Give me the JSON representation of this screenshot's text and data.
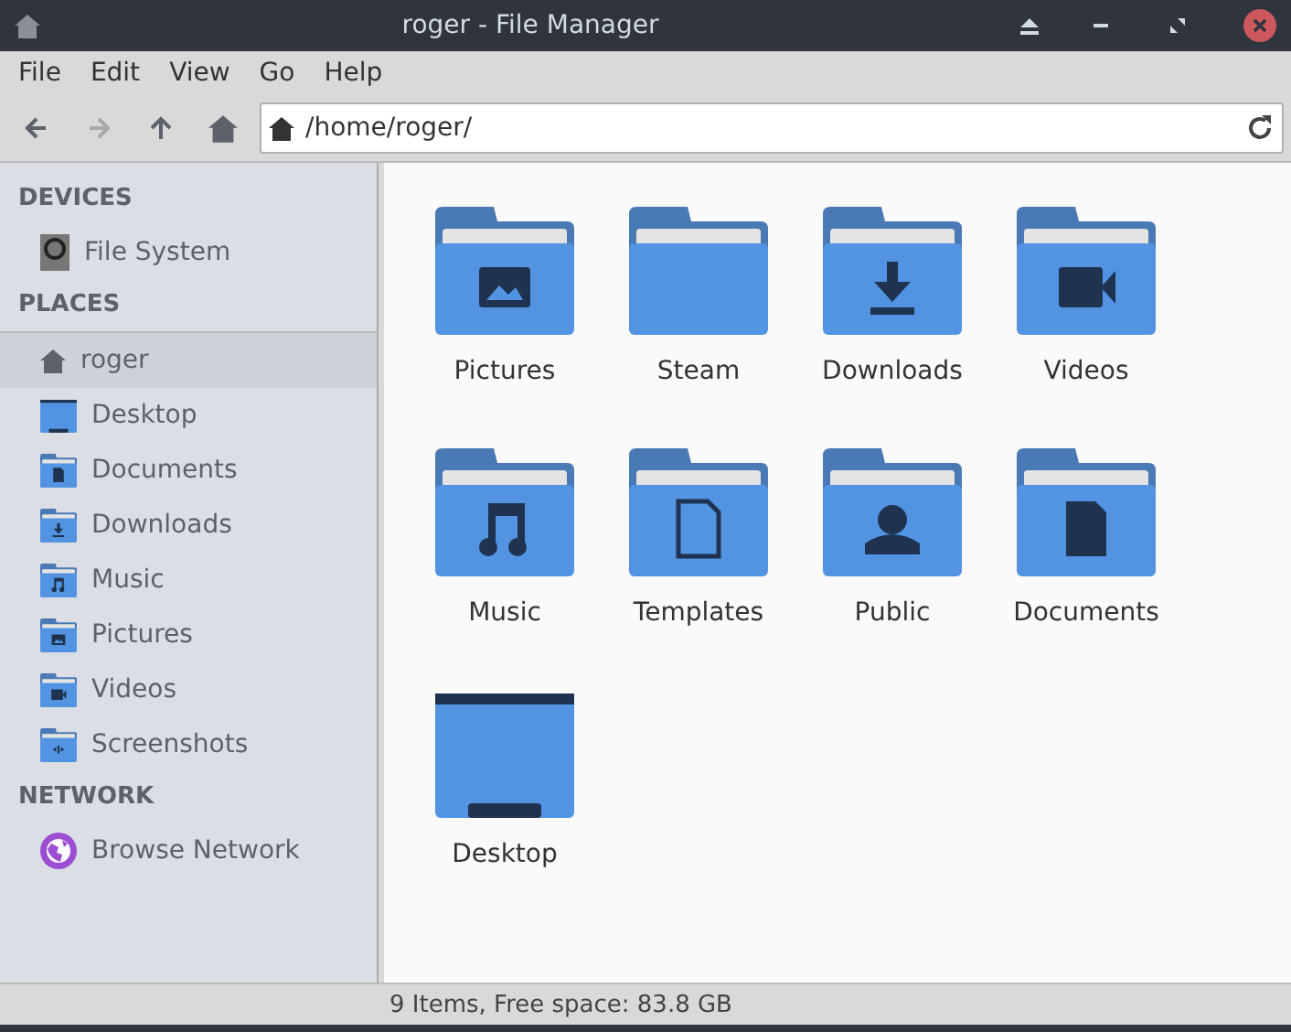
{
  "window": {
    "title": "roger - File Manager"
  },
  "menu": [
    "File",
    "Edit",
    "View",
    "Go",
    "Help"
  ],
  "toolbar": [
    {
      "kind": "back",
      "disabled": false
    },
    {
      "kind": "forward",
      "disabled": true
    },
    {
      "kind": "up",
      "disabled": false
    },
    {
      "kind": "home",
      "disabled": false
    }
  ],
  "location": {
    "value": "/home/roger/"
  },
  "sidebar": [
    {
      "heading": "DEVICES",
      "items": [
        {
          "label": "File System",
          "kind": "drive",
          "selected": false
        }
      ]
    },
    {
      "heading": "PLACES",
      "items": [
        {
          "label": "roger",
          "kind": "home",
          "selected": true
        },
        {
          "label": "Desktop",
          "kind": "desktop",
          "selected": false
        },
        {
          "label": "Documents",
          "kind": "document",
          "selected": false
        },
        {
          "label": "Downloads",
          "kind": "download",
          "selected": false
        },
        {
          "label": "Music",
          "kind": "music",
          "selected": false
        },
        {
          "label": "Pictures",
          "kind": "picture",
          "selected": false
        },
        {
          "label": "Videos",
          "kind": "video",
          "selected": false
        },
        {
          "label": "Screenshots",
          "kind": "screenshot",
          "selected": false
        }
      ]
    },
    {
      "heading": "NETWORK",
      "items": [
        {
          "label": "Browse Network",
          "kind": "network",
          "selected": false
        }
      ]
    }
  ],
  "folders": [
    {
      "label": "Pictures",
      "kind": "picture"
    },
    {
      "label": "Steam",
      "kind": "plain"
    },
    {
      "label": "Downloads",
      "kind": "download"
    },
    {
      "label": "Videos",
      "kind": "video"
    },
    {
      "label": "Music",
      "kind": "music"
    },
    {
      "label": "Templates",
      "kind": "template"
    },
    {
      "label": "Public",
      "kind": "person"
    },
    {
      "label": "Documents",
      "kind": "document"
    },
    {
      "label": "Desktop",
      "kind": "desktop"
    }
  ],
  "status_bar": "9 Items, Free space: 83.8 GB"
}
